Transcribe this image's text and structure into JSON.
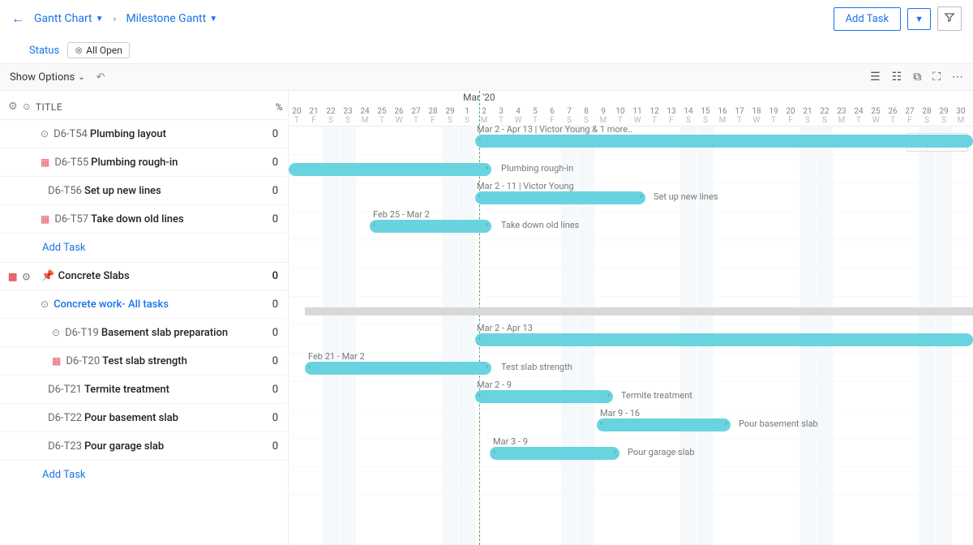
{
  "breadcrumb": {
    "back": "←",
    "item1": "Gantt Chart",
    "item2": "Milestone Gantt"
  },
  "actions": {
    "addTask": "Add Task"
  },
  "filter": {
    "statusLabel": "Status",
    "pill": "All Open"
  },
  "options": {
    "show": "Show Options"
  },
  "headers": {
    "title": "TITLE",
    "pct": "%",
    "month": "Mar '20"
  },
  "days": [
    "20",
    "21",
    "22",
    "23",
    "24",
    "25",
    "26",
    "27",
    "28",
    "29",
    "1",
    "2",
    "3",
    "4",
    "5",
    "6",
    "7",
    "8",
    "9",
    "10",
    "11",
    "12",
    "13",
    "14",
    "15",
    "16",
    "17",
    "18",
    "19",
    "20",
    "21",
    "22",
    "23",
    "24",
    "25",
    "26",
    "27",
    "28",
    "29",
    "30"
  ],
  "dows": [
    "T",
    "F",
    "S",
    "S",
    "M",
    "T",
    "W",
    "T",
    "F",
    "S",
    "S",
    "M",
    "T",
    "W",
    "T",
    "F",
    "S",
    "S",
    "M",
    "T",
    "W",
    "T",
    "F",
    "S",
    "S",
    "M",
    "T",
    "W",
    "T",
    "F",
    "S",
    "S",
    "M",
    "T",
    "W",
    "T",
    "F",
    "S",
    "S",
    "M"
  ],
  "rows": [
    {
      "code": "D6-T54",
      "title": "Plumbing layout",
      "pct": "0",
      "icon": "chev"
    },
    {
      "code": "D6-T55",
      "title": "Plumbing rough-in",
      "pct": "0",
      "icon": "cal"
    },
    {
      "code": "D6-T56",
      "title": "Set up new lines",
      "pct": "0",
      "icon": "none"
    },
    {
      "code": "D6-T57",
      "title": "Take down old lines",
      "pct": "0",
      "icon": "cal"
    }
  ],
  "section": {
    "title": "Concrete Slabs",
    "pct": "0"
  },
  "subrow": {
    "title": "Concrete work- All tasks",
    "pct": "0"
  },
  "rows2": [
    {
      "code": "D6-T19",
      "title": "Basement slab preparation",
      "pct": "0",
      "icon": "chev"
    },
    {
      "code": "D6-T20",
      "title": "Test slab strength",
      "pct": "0",
      "icon": "cal"
    },
    {
      "code": "D6-T21",
      "title": "Termite treatment",
      "pct": "0",
      "icon": "none"
    },
    {
      "code": "D6-T22",
      "title": "Pour basement slab",
      "pct": "0",
      "icon": "none"
    },
    {
      "code": "D6-T23",
      "title": "Pour garage slab",
      "pct": "0",
      "icon": "none"
    }
  ],
  "addTaskLink": "Add Task",
  "labels": {
    "l1": "Mar 2 - Apr 13 | Victor Young & 1 more..",
    "l2": "Plumbing rough-in",
    "l3": "Mar 2 - 11 | Victor Young",
    "l4": "Set up new lines",
    "l5": "Feb 25 - Mar 2",
    "l6": "Take down old lines",
    "l7": "Mar 2 - Apr 13",
    "l8": "Feb 21 - Mar 2",
    "l9": "Test slab strength",
    "l10": "Mar 2 - 9",
    "l11": "Termite treatment",
    "l12": "Mar 9 - 16",
    "l13": "Pour basement slab",
    "l14": "Mar 3 - 9",
    "l15": "Pour garage slab"
  },
  "chart_data": {
    "type": "gantt",
    "date_range": {
      "start": "2020-02-20",
      "end": "2020-03-30",
      "today_marker": "2020-03-02"
    },
    "tasks": [
      {
        "id": "D6-T54",
        "name": "Plumbing layout",
        "start": "2020-03-02",
        "end": "2020-04-13",
        "assignee": "Victor Young & 1 more",
        "pct": 0
      },
      {
        "id": "D6-T55",
        "name": "Plumbing rough-in",
        "start": "2020-02-20",
        "end": "2020-03-02",
        "pct": 0
      },
      {
        "id": "D6-T56",
        "name": "Set up new lines",
        "start": "2020-03-02",
        "end": "2020-03-11",
        "assignee": "Victor Young",
        "pct": 0
      },
      {
        "id": "D6-T57",
        "name": "Take down old lines",
        "start": "2020-02-25",
        "end": "2020-03-02",
        "pct": 0
      },
      {
        "id": "group",
        "name": "Concrete Slabs",
        "pct": 0
      },
      {
        "id": "summary",
        "name": "Concrete work- All tasks",
        "start": "2020-02-21",
        "end": "2020-04-13",
        "pct": 0
      },
      {
        "id": "D6-T19",
        "name": "Basement slab preparation",
        "start": "2020-03-02",
        "end": "2020-04-13",
        "pct": 0
      },
      {
        "id": "D6-T20",
        "name": "Test slab strength",
        "start": "2020-02-21",
        "end": "2020-03-02",
        "pct": 0
      },
      {
        "id": "D6-T21",
        "name": "Termite treatment",
        "start": "2020-03-02",
        "end": "2020-03-09",
        "pct": 0
      },
      {
        "id": "D6-T22",
        "name": "Pour basement slab",
        "start": "2020-03-09",
        "end": "2020-03-16",
        "pct": 0
      },
      {
        "id": "D6-T23",
        "name": "Pour garage slab",
        "start": "2020-03-03",
        "end": "2020-03-09",
        "pct": 0
      }
    ]
  }
}
